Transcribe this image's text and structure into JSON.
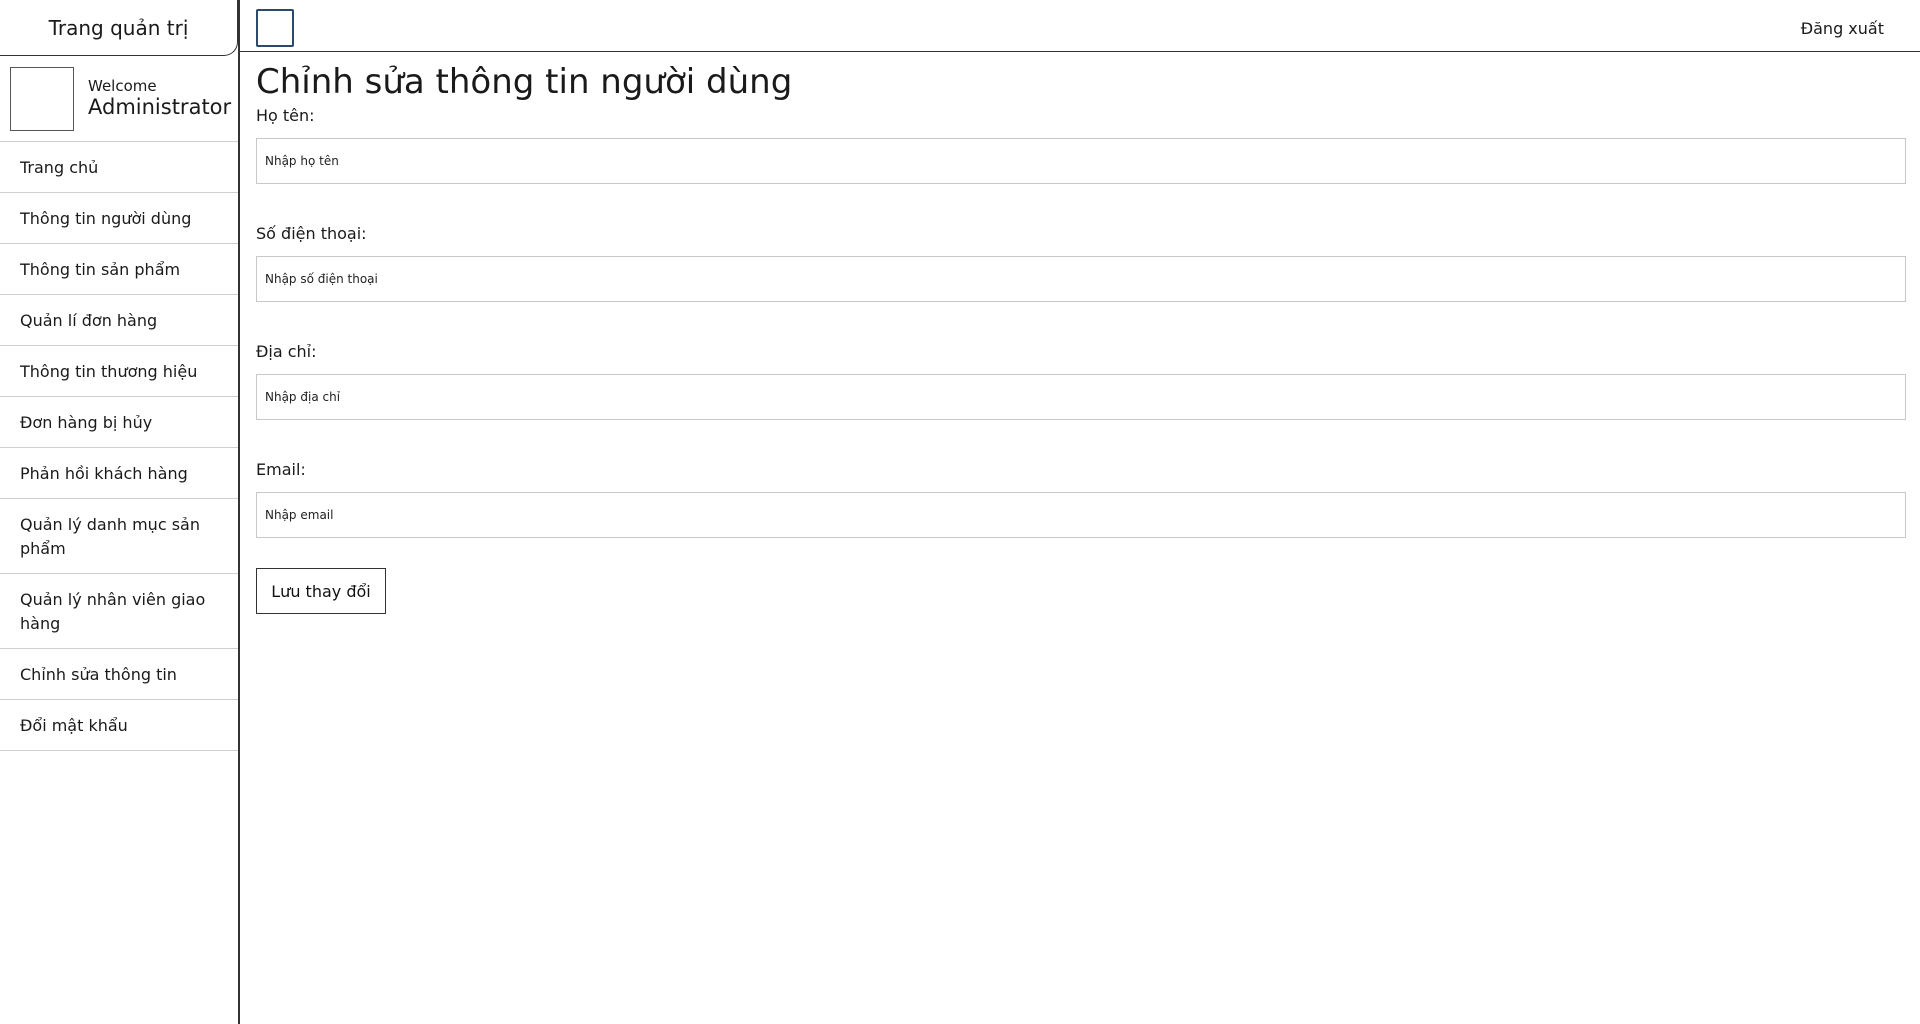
{
  "sidebar": {
    "title": "Trang quản trị",
    "welcome_text": "Welcome",
    "user_name": "Administrator",
    "items": [
      {
        "label": "Trang chủ"
      },
      {
        "label": "Thông tin người dùng"
      },
      {
        "label": "Thông tin sản phẩm"
      },
      {
        "label": "Quản lí đơn hàng"
      },
      {
        "label": "Thông tin thương hiệu"
      },
      {
        "label": "Đơn hàng bị hủy"
      },
      {
        "label": "Phản hồi khách hàng"
      },
      {
        "label": "Quản lý danh mục sản phẩm"
      },
      {
        "label": "Quản lý nhân viên giao hàng"
      },
      {
        "label": "Chỉnh sửa thông tin"
      },
      {
        "label": "Đổi mật khẩu"
      }
    ]
  },
  "topbar": {
    "logout_label": "Đăng xuất"
  },
  "main": {
    "title": "Chỉnh sửa thông tin người dùng",
    "fields": [
      {
        "label": "Họ tên:",
        "placeholder": "Nhập họ tên",
        "value": ""
      },
      {
        "label": "Số điện thoại:",
        "placeholder": "Nhập số điện thoại",
        "value": ""
      },
      {
        "label": "Địa chỉ:",
        "placeholder": "Nhập địa chỉ",
        "value": ""
      },
      {
        "label": "Email:",
        "placeholder": "Nhập email",
        "value": ""
      }
    ],
    "save_label": "Lưu thay đổi"
  }
}
